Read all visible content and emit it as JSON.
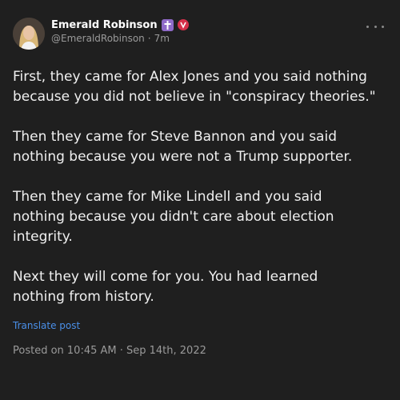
{
  "author": {
    "name": "Emerald Robinson",
    "handle": "@EmeraldRobinson",
    "separator": "·",
    "time_ago": "7m",
    "badge_cross_icon": "cross-icon",
    "badge_verified_icon": "verified-badge-icon"
  },
  "post": {
    "paragraphs": [
      "First, they came for Alex Jones and you said nothing\nbecause you did not believe in \"conspiracy theories.\"",
      "Then they came for Steve Bannon and you said\nnothing because you were not a Trump supporter.",
      "Then they came for Mike Lindell and you said\nnothing because you didn't care about election\nintegrity.",
      "Next they will come for you. You had learned\nnothing from history."
    ],
    "translate_label": "Translate post",
    "posted_text": "Posted on 10:45 AM · Sep 14th, 2022"
  },
  "colors": {
    "background": "#1f1f1f",
    "link": "#4a8fe8",
    "cross_badge": "#8f6ac8",
    "verified_badge": "#d6304a"
  }
}
